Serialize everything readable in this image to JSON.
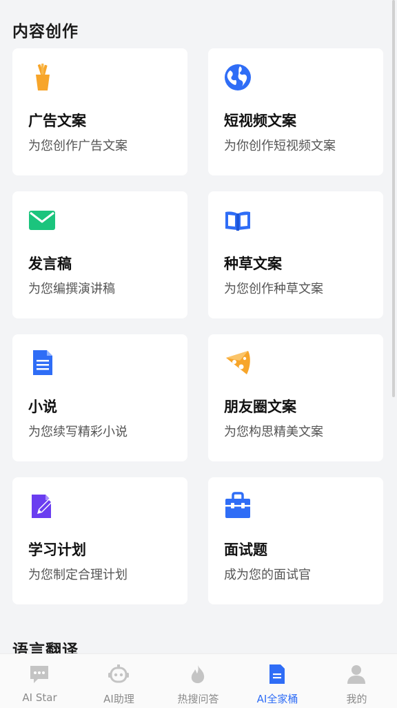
{
  "sections": {
    "content_creation": "内容创作",
    "translation": "语言翻译"
  },
  "cards": [
    {
      "title": "广告文案",
      "subtitle": "为您创作广告文案",
      "icon": "pencil-cup-icon"
    },
    {
      "title": "短视频文案",
      "subtitle": "为你创作短视频文案",
      "icon": "globe-icon"
    },
    {
      "title": "发言稿",
      "subtitle": "为您编撰演讲稿",
      "icon": "envelope-icon"
    },
    {
      "title": "种草文案",
      "subtitle": "为您创作种草文案",
      "icon": "open-book-icon"
    },
    {
      "title": "小说",
      "subtitle": "为您续写精彩小说",
      "icon": "document-icon"
    },
    {
      "title": "朋友圈文案",
      "subtitle": "为您构思精美文案",
      "icon": "cheese-icon"
    },
    {
      "title": "学习计划",
      "subtitle": "为您制定合理计划",
      "icon": "edit-note-icon"
    },
    {
      "title": "面试题",
      "subtitle": "成为您的面试官",
      "icon": "toolbox-icon"
    }
  ],
  "tabs": [
    {
      "label": "AI Star",
      "icon": "chat-bubble-icon",
      "active": false
    },
    {
      "label": "AI助理",
      "icon": "robot-icon",
      "active": false
    },
    {
      "label": "热搜问答",
      "icon": "flame-icon",
      "active": false
    },
    {
      "label": "AI全家桶",
      "icon": "document-icon",
      "active": true
    },
    {
      "label": "我的",
      "icon": "user-icon",
      "active": false
    }
  ],
  "colors": {
    "accent": "#2f6df6",
    "orange": "#f7a52a",
    "green": "#1bc47d",
    "purple": "#6a3df0",
    "inactive": "#c4c4c4"
  }
}
